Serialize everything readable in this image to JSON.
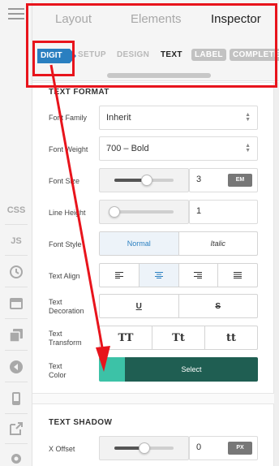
{
  "rail": {
    "items": [
      "CSS",
      "JS"
    ]
  },
  "top_tabs": [
    "Layout",
    "Elements",
    "Inspector"
  ],
  "sub_tabs": {
    "digit": "DIGIT",
    "setup": "SETUP",
    "design": "DESIGN",
    "text": "TEXT",
    "label": "LABEL",
    "complete": "COMPLETE"
  },
  "text_format": {
    "title": "TEXT FORMAT",
    "font_family": {
      "label": "Font Family",
      "value": "Inherit"
    },
    "font_weight": {
      "label": "Font Weight",
      "value": "700 – Bold"
    },
    "font_size": {
      "label": "Font Size",
      "value": "3",
      "unit": "EM",
      "slider_level": 0.55
    },
    "line_height": {
      "label": "Line Height",
      "value": "1",
      "slider_level": 0.0
    },
    "font_style": {
      "label": "Font Style",
      "options": [
        "Normal",
        "Italic"
      ],
      "selected": "Normal"
    },
    "text_align": {
      "label": "Text Align",
      "options": [
        "left-align-icon",
        "center-align-icon",
        "right-align-icon",
        "justify-align-icon"
      ],
      "selected": "center"
    },
    "text_decoration": {
      "label": "Text Decoration",
      "options": [
        "U",
        "S"
      ]
    },
    "text_transform": {
      "label": "Text Transform",
      "options": [
        "TT",
        "Tt",
        "tt"
      ]
    },
    "text_color": {
      "label": "Text Color",
      "swatch": "#3cc2a7",
      "button": "Select"
    }
  },
  "text_shadow": {
    "title": "TEXT SHADOW",
    "x_offset": {
      "label": "X Offset",
      "value": "0",
      "unit": "PX",
      "slider_level": 0.5
    }
  },
  "colors": {
    "accent": "#2a7fc0",
    "annotation": "#e8141c",
    "select_button": "#1f5e52"
  }
}
